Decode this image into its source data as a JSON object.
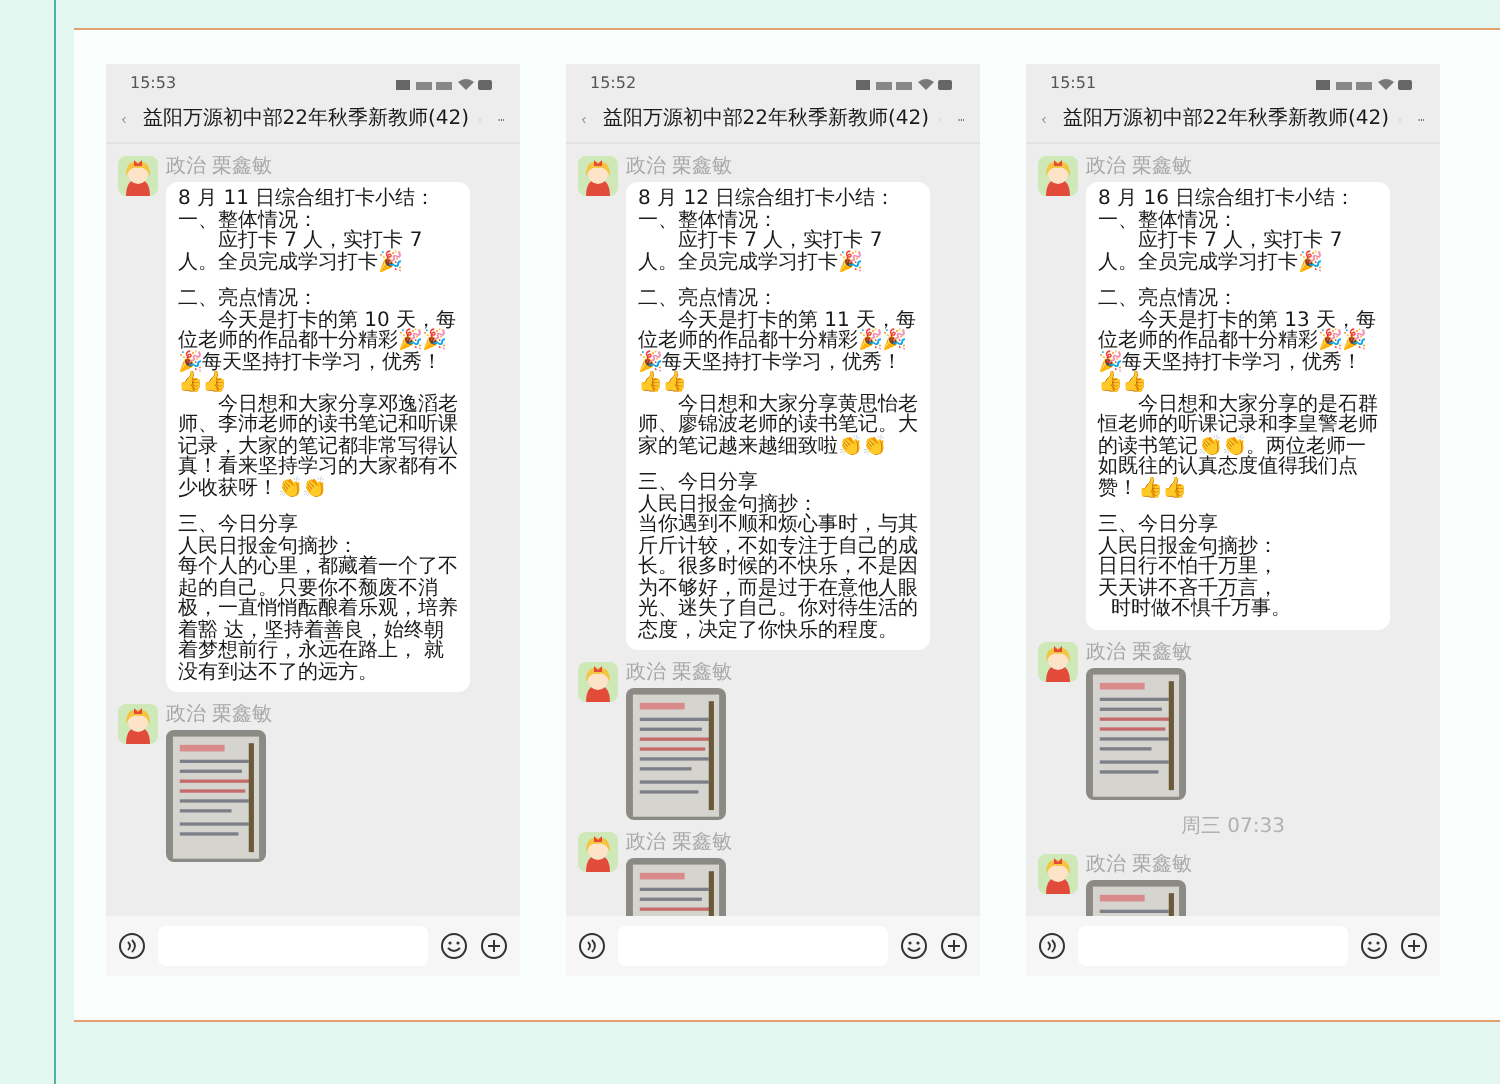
{
  "phones": [
    {
      "time": "15:53",
      "title": "益阳万源初中部22年秋季新教师(42)",
      "messages": [
        {
          "kind": "text",
          "sender": "政治 栗鑫敏",
          "sections": [
            [
              "8 月 11 日综合组打卡小结：",
              "一、整体情况：",
              "　　应打卡 7 人，实打卡 7 人。全员完成学习打卡🎉"
            ],
            [
              "二、亮点情况：",
              "　　今天是打卡的第 10 天，每位老师的作品都十分精彩🎉🎉🎉每天坚持打卡学习，优秀！👍👍",
              "　　今日想和大家分享邓逸滔老师、李沛老师的读书笔记和听课记录，大家的笔记都非常写得认真！看来坚持学习的大家都有不少收获呀！👏👏"
            ],
            [
              "三、今日分享",
              "人民日报金句摘抄：",
              "每个人的心里，都藏着一个了不起的自己。只要你不颓废不消极，一直悄悄酝酿着乐观，培养着豁 达，坚持着善良，始终朝着梦想前行，永远在路上， 就没有到达不了的远方。"
            ]
          ]
        },
        {
          "sender": "政治 栗鑫敏"
        }
      ]
    },
    {
      "time": "15:52",
      "title": "益阳万源初中部22年秋季新教师(42)",
      "messages": [
        {
          "kind": "text",
          "sender": "政治 栗鑫敏",
          "sections": [
            [
              "8 月 12 日综合组打卡小结：",
              "一、整体情况：",
              "　　应打卡 7 人，实打卡 7 人。全员完成学习打卡🎉"
            ],
            [
              "二、亮点情况：",
              "　　今天是打卡的第 11 天，每位老师的作品都十分精彩🎉🎉🎉每天坚持打卡学习，优秀！👍👍",
              "　　今日想和大家分享黄思怡老师、廖锦波老师的读书笔记。大家的笔记越来越细致啦👏👏"
            ],
            [
              "三、今日分享",
              "人民日报金句摘抄：",
              "当你遇到不顺和烦心事时，与其斤斤计较，不如专注于自己的成长。很多时候的不快乐，不是因为不够好，而是过于在意他人眼光、迷失了自己。你对待生活的态度，决定了你快乐的程度。"
            ]
          ]
        },
        {
          "sender": "政治 栗鑫敏"
        },
        {
          "sender": "政治 栗鑫敏"
        }
      ]
    },
    {
      "time": "15:51",
      "title": "益阳万源初中部22年秋季新教师(42)",
      "messages": [
        {
          "kind": "text",
          "sender": "政治 栗鑫敏",
          "sections": [
            [
              "8 月 16 日综合组打卡小结：",
              "一、整体情况：",
              "　　应打卡 7 人，实打卡 7 人。全员完成学习打卡🎉"
            ],
            [
              "二、亮点情况：",
              "　　今天是打卡的第 13 天，每位老师的作品都十分精彩🎉🎉🎉每天坚持打卡学习，优秀！👍👍",
              "　　今日想和大家分享的是石群恒老师的听课记录和李皇警老师的读书笔记👏👏。两位老师一如既往的认真态度值得我们点赞！👍👍"
            ],
            [
              "三、今日分享",
              "人民日报金句摘抄：",
              "日日行不怕千万里，",
              "天天讲不吝千万言，",
              "  时时做不惧千万事。"
            ]
          ]
        },
        {
          "sender": "政治 栗鑫敏"
        },
        {
          "kind": "timestamp",
          "text": "周三 07:33"
        },
        {
          "sender": "政治 栗鑫敏"
        }
      ]
    }
  ]
}
